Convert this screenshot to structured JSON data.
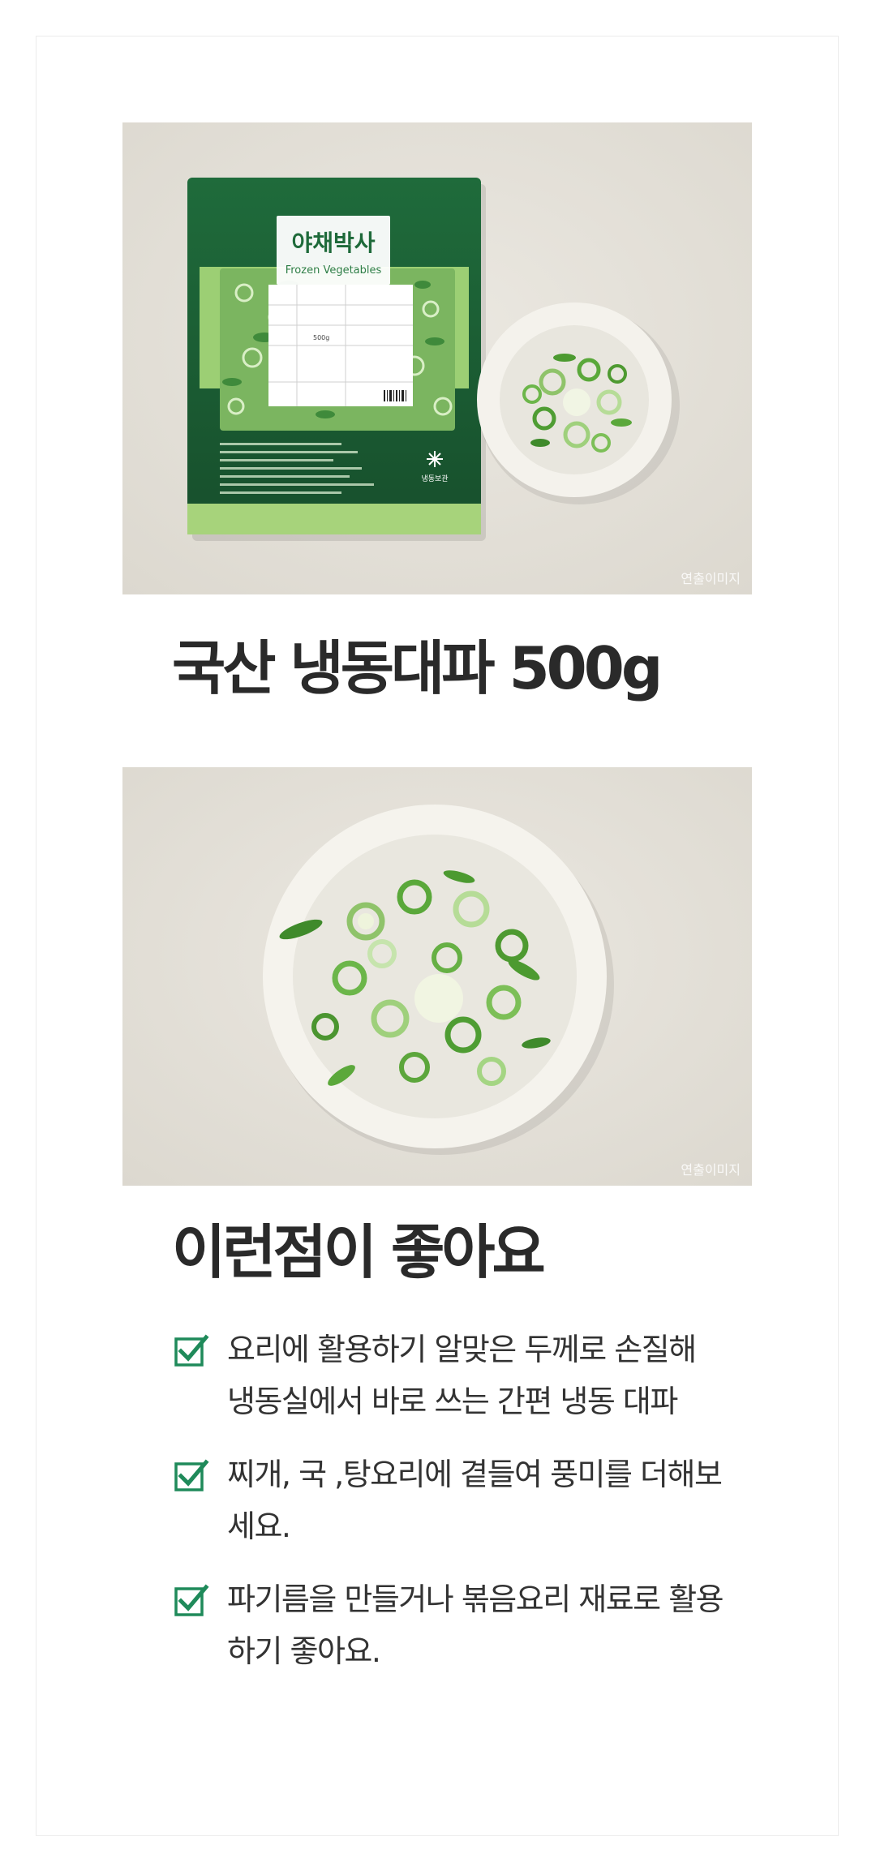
{
  "product": {
    "image_watermark": "연출이미지",
    "package_brand": "야채박사",
    "package_subtitle": "Frozen Vegetables",
    "package_weight": "500g",
    "package_storage": "냉동보관",
    "title": "국산 냉동대파 500g"
  },
  "serving": {
    "image_watermark": "연출이미지"
  },
  "benefits": {
    "title": "이런점이 좋아요",
    "items": [
      {
        "text": "요리에 활용하기 알맞은 두께로 손질해 냉동실에서 바로 쓰는 간편 냉동 대파"
      },
      {
        "text": "찌개, 국 ,탕요리에 곁들여  풍미를 더해보세요."
      },
      {
        "text": "파기름을 만들거나 볶음요리 재료로 활용하기 좋아요."
      }
    ]
  },
  "colors": {
    "check": "#1f8a5a",
    "package_green": "#1b5e34",
    "scallion_green": "#5fae3c"
  }
}
